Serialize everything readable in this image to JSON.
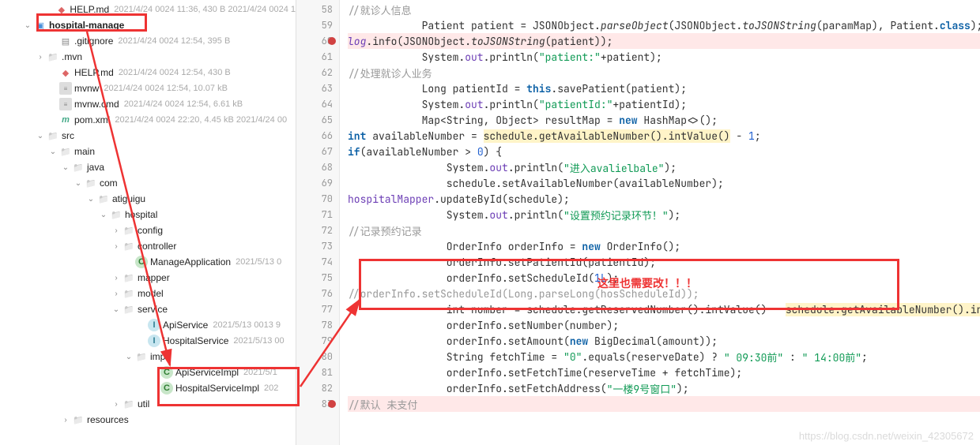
{
  "tree": [
    {
      "indent": 2,
      "arrow": "",
      "icon": "md",
      "name": "HELP.md",
      "meta": "2021/4/24 0024 11:36, 430 B 2021/4/24 0024 1"
    },
    {
      "indent": 0,
      "arrow": "v",
      "icon": "folder-blue",
      "name": "hospital-manage",
      "meta": "",
      "bold": true
    },
    {
      "indent": 2,
      "arrow": "",
      "icon": "file",
      "name": ".gitignore",
      "meta": "2021/4/24 0024 12:54, 395 B"
    },
    {
      "indent": 1,
      "arrow": ">",
      "icon": "folder",
      "name": ".mvn",
      "meta": ""
    },
    {
      "indent": 2,
      "arrow": "",
      "icon": "md",
      "name": "HELP.md",
      "meta": "2021/4/24 0024 12:54, 430 B"
    },
    {
      "indent": 2,
      "arrow": "",
      "icon": "cmd",
      "name": "mvnw",
      "meta": "2021/4/24 0024 12:54, 10.07 kB"
    },
    {
      "indent": 2,
      "arrow": "",
      "icon": "cmd",
      "name": "mvnw.cmd",
      "meta": "2021/4/24 0024 12:54, 6.61 kB"
    },
    {
      "indent": 2,
      "arrow": "",
      "icon": "xml",
      "name": "pom.xml",
      "meta": "2021/4/24 0024 22:20, 4.45 kB 2021/4/24 00"
    },
    {
      "indent": 1,
      "arrow": "v",
      "icon": "folder",
      "name": "src",
      "meta": ""
    },
    {
      "indent": 2,
      "arrow": "v",
      "icon": "folder",
      "name": "main",
      "meta": ""
    },
    {
      "indent": 3,
      "arrow": "v",
      "icon": "folder",
      "name": "java",
      "meta": ""
    },
    {
      "indent": 4,
      "arrow": "v",
      "icon": "folder",
      "name": "com",
      "meta": ""
    },
    {
      "indent": 5,
      "arrow": "v",
      "icon": "folder",
      "name": "atiguigu",
      "meta": ""
    },
    {
      "indent": 6,
      "arrow": "v",
      "icon": "folder",
      "name": "hospital",
      "meta": ""
    },
    {
      "indent": 7,
      "arrow": ">",
      "icon": "folder",
      "name": "config",
      "meta": ""
    },
    {
      "indent": 7,
      "arrow": ">",
      "icon": "folder",
      "name": "controller",
      "meta": ""
    },
    {
      "indent": 8,
      "arrow": "",
      "icon": "java-c",
      "name": "ManageApplication",
      "meta": "2021/5/13 0"
    },
    {
      "indent": 7,
      "arrow": ">",
      "icon": "folder",
      "name": "mapper",
      "meta": ""
    },
    {
      "indent": 7,
      "arrow": ">",
      "icon": "folder",
      "name": "model",
      "meta": ""
    },
    {
      "indent": 7,
      "arrow": "v",
      "icon": "folder",
      "name": "service",
      "meta": ""
    },
    {
      "indent": 9,
      "arrow": "",
      "icon": "java-i",
      "name": "ApiService",
      "meta": "2021/5/13 0013 9"
    },
    {
      "indent": 9,
      "arrow": "",
      "icon": "java-i",
      "name": "HospitalService",
      "meta": "2021/5/13 00"
    },
    {
      "indent": 8,
      "arrow": "v",
      "icon": "folder",
      "name": "impl",
      "meta": ""
    },
    {
      "indent": 10,
      "arrow": "",
      "icon": "java-c",
      "name": "ApiServiceImpl",
      "meta": "2021/5/1"
    },
    {
      "indent": 10,
      "arrow": "",
      "icon": "java-c",
      "name": "HospitalServiceImpl",
      "meta": "202"
    },
    {
      "indent": 7,
      "arrow": ">",
      "icon": "folder",
      "name": "util",
      "meta": ""
    },
    {
      "indent": 3,
      "arrow": ">",
      "icon": "folder",
      "name": "resources",
      "meta": ""
    }
  ],
  "gutter_start": 58,
  "breakpoints": [
    60,
    83
  ],
  "code": [
    {
      "n": 58,
      "html": "            <span class='c-comment'>//就诊人信息</span>"
    },
    {
      "n": 59,
      "html": "            Patient patient = JSONObject.<span class='c-method-s'>parseObject</span>(JSONObject.<span class='c-method-s'>toJSONString</span>(paramMap), Patient.<span class='c-kw'>class</span>);"
    },
    {
      "n": 60,
      "hl": "hl-bkpt",
      "html": "            <span class='c-static'>log</span>.info(JSONObject.<span class='c-method-s'>toJSONString</span>(patient));"
    },
    {
      "n": 61,
      "html": "            System.<span class='c-field'>out</span>.println(<span class='c-str'>\"patient:\"</span>+patient);"
    },
    {
      "n": 62,
      "html": "            <span class='c-comment'>//处理就诊人业务</span>"
    },
    {
      "n": 63,
      "html": "            Long patientId = <span class='c-kw'>this</span>.savePatient(patient);"
    },
    {
      "n": 64,
      "html": "            System.<span class='c-field'>out</span>.println(<span class='c-str'>\"patientId:\"</span>+patientId);"
    },
    {
      "n": 65,
      "html": "            Map&lt;String, Object&gt; resultMap = <span class='c-kw'>new</span> HashMap&lt;&gt;();"
    },
    {
      "n": 66,
      "html": "            <span class='c-kw'>int</span> availableNumber = <span class='hl-yel'>schedule.getAvailableNumber().intValue()</span> - <span class='c-num'>1</span>;"
    },
    {
      "n": 67,
      "html": "            <span class='c-kw'>if</span>(availableNumber &gt; <span class='c-num'>0</span>) {"
    },
    {
      "n": 68,
      "html": "                System.<span class='c-field'>out</span>.println(<span class='c-str'>\"进入avalielbale\"</span>);"
    },
    {
      "n": 69,
      "html": "                schedule.setAvailableNumber(availableNumber);"
    },
    {
      "n": 70,
      "html": "                <span class='c-field'>hospitalMapper</span>.updateById(schedule);"
    },
    {
      "n": 71,
      "html": "                System.<span class='c-field'>out</span>.println(<span class='c-str'>\"设置预约记录环节！\"</span>);"
    },
    {
      "n": 72,
      "html": "                <span class='c-comment'>//记录预约记录</span>"
    },
    {
      "n": 73,
      "html": "                OrderInfo orderInfo = <span class='c-kw'>new</span> OrderInfo();"
    },
    {
      "n": 74,
      "html": "                orderInfo.setPatientId(patientId);"
    },
    {
      "n": 75,
      "html": "                orderInfo.setScheduleId(<span class='c-num'>1L</span>);"
    },
    {
      "n": 76,
      "html": "                <span class='c-comment'>//orderInfo.setScheduleId(Long.parseLong(hosScheduleId));</span>"
    },
    {
      "n": 77,
      "html": "                int number = schedule.getReservedNumber().intValue() - <span class='hl-yel'>schedule.getAvailableNumber().int</span>"
    },
    {
      "n": 78,
      "html": "                orderInfo.setNumber(number);"
    },
    {
      "n": 79,
      "html": "                orderInfo.setAmount(<span class='c-kw'>new</span> BigDecimal(amount));"
    },
    {
      "n": 80,
      "html": "                String fetchTime = <span class='c-str'>\"0\"</span>.equals(reserveDate) ? <span class='c-str'>\" 09:30前\"</span> : <span class='c-str'>\" 14:00前\"</span>;"
    },
    {
      "n": 81,
      "html": "                orderInfo.setFetchTime(reserveTime + fetchTime);"
    },
    {
      "n": 82,
      "html": "                orderInfo.setFetchAddress(<span class='c-str'>\"一楼9号窗口\"</span>);"
    },
    {
      "n": 83,
      "hl": "hl-bkpt",
      "html": "                <span class='c-comment'>//默认 未支付</span>"
    }
  ],
  "annotation_text": "这里也需要改！！！",
  "watermark": "https://blog.csdn.net/weixin_42305672"
}
